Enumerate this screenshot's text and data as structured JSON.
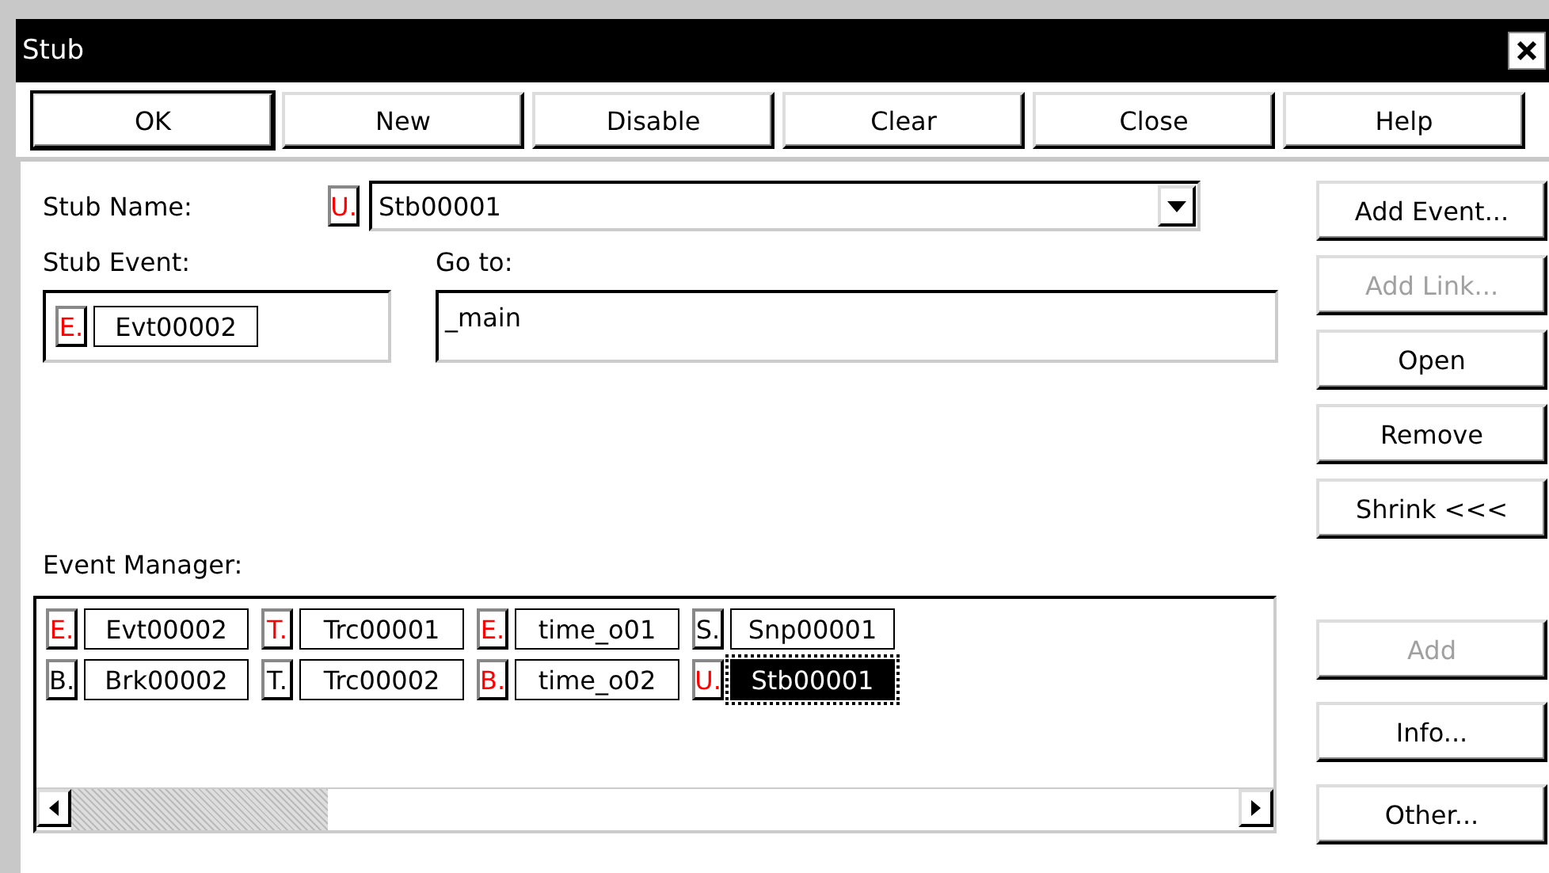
{
  "window": {
    "title": "Stub"
  },
  "toolbar": [
    {
      "label": "OK",
      "default": true
    },
    {
      "label": "New",
      "default": false
    },
    {
      "label": "Disable",
      "default": false
    },
    {
      "label": "Clear",
      "default": false
    },
    {
      "label": "Close",
      "default": false
    },
    {
      "label": "Help",
      "default": false
    }
  ],
  "stub_name": {
    "label": "Stub Name:",
    "badge": {
      "text": "U.",
      "color": "#ff0000"
    },
    "value": "Stb00001"
  },
  "stub_event": {
    "label": "Stub Event:",
    "badge": {
      "text": "E.",
      "color": "#ff0000"
    },
    "value": "Evt00002"
  },
  "go_to": {
    "label": "Go to:",
    "value": "_main"
  },
  "side_buttons": [
    {
      "label": "Add Event...",
      "disabled": false
    },
    {
      "label": "Add Link...",
      "disabled": true
    },
    {
      "label": "Open",
      "disabled": false
    },
    {
      "label": "Remove",
      "disabled": false
    },
    {
      "label": "Shrink <<<",
      "disabled": false
    }
  ],
  "event_manager": {
    "label": "Event Manager:",
    "events": [
      {
        "badge": "E.",
        "color": "#ff0000",
        "name": "Evt00002",
        "selected": false
      },
      {
        "badge": "T.",
        "color": "#ff0000",
        "name": "Trc00001",
        "selected": false
      },
      {
        "badge": "E.",
        "color": "#ff0000",
        "name": "time_o01",
        "selected": false
      },
      {
        "badge": "S.",
        "color": "#000000",
        "name": "Snp00001",
        "selected": false
      },
      {
        "badge": "B.",
        "color": "#000000",
        "name": "Brk00002",
        "selected": false
      },
      {
        "badge": "T.",
        "color": "#000000",
        "name": "Trc00002",
        "selected": false
      },
      {
        "badge": "B.",
        "color": "#ff0000",
        "name": "time_o02",
        "selected": false
      },
      {
        "badge": "U.",
        "color": "#ff0000",
        "name": "Stb00001",
        "selected": true
      }
    ]
  },
  "lower_buttons": [
    {
      "label": "Add",
      "disabled": true
    },
    {
      "label": "Info...",
      "disabled": false
    },
    {
      "label": "Other...",
      "disabled": false
    }
  ]
}
